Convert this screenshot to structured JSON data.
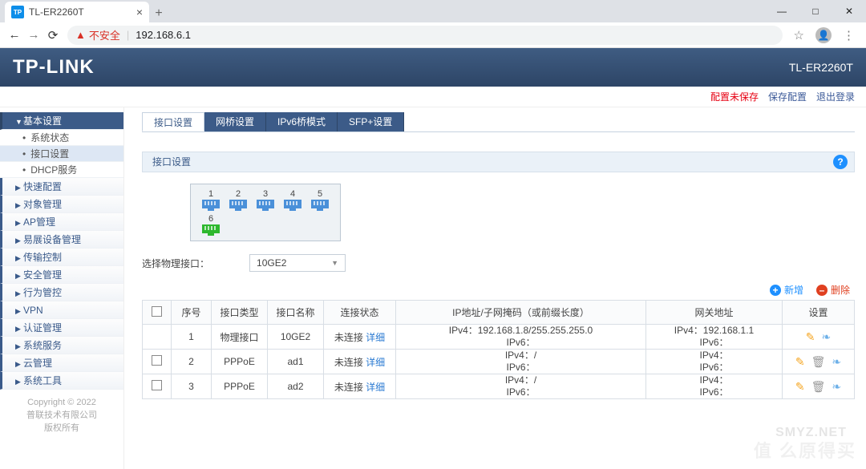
{
  "browser": {
    "tab_title": "TL-ER2260T",
    "favicon": "TP",
    "address_warn": "不安全",
    "address_url": "192.168.6.1",
    "newtab": "+",
    "close": "×",
    "win": {
      "min": "—",
      "max": "□",
      "close": "✕"
    },
    "nav": {
      "back": "←",
      "fwd": "→",
      "reload": "⟳"
    },
    "star": "☆",
    "user_glyph": "●",
    "menu": "⋮"
  },
  "banner": {
    "brand": "TP-LINK",
    "model": "TL-ER2260T"
  },
  "actionbar": {
    "unsaved": "配置未保存",
    "save": "保存配置",
    "logout": "退出登录"
  },
  "sidebar": {
    "items": [
      {
        "label": "基本设置",
        "children": [
          {
            "label": "系统状态"
          },
          {
            "label": "接口设置",
            "active": true
          },
          {
            "label": "DHCP服务"
          }
        ]
      },
      {
        "label": "快速配置"
      },
      {
        "label": "对象管理"
      },
      {
        "label": "AP管理"
      },
      {
        "label": "易展设备管理"
      },
      {
        "label": "传输控制"
      },
      {
        "label": "安全管理"
      },
      {
        "label": "行为管控"
      },
      {
        "label": "VPN"
      },
      {
        "label": "认证管理"
      },
      {
        "label": "系统服务"
      },
      {
        "label": "云管理"
      },
      {
        "label": "系统工具"
      }
    ],
    "copyright": {
      "l1": "Copyright © 2022",
      "l2": "普联技术有限公司",
      "l3": "版权所有"
    }
  },
  "tabs": [
    {
      "label": "接口设置",
      "active": true
    },
    {
      "label": "网桥设置"
    },
    {
      "label": "IPv6桥模式"
    },
    {
      "label": "SFP+设置"
    }
  ],
  "panel": {
    "title": "接口设置",
    "help": "?",
    "ports": [
      {
        "num": "1",
        "state": "blue"
      },
      {
        "num": "2",
        "state": "blue"
      },
      {
        "num": "3",
        "state": "blue"
      },
      {
        "num": "4",
        "state": "blue"
      },
      {
        "num": "5",
        "state": "blue"
      },
      {
        "num": "6",
        "state": "green"
      }
    ],
    "select_label": "选择物理接口：",
    "select_value": "10GE2",
    "actions": {
      "add": "新增",
      "del": "删除"
    },
    "columns": {
      "idx": "序号",
      "type": "接口类型",
      "name": "接口名称",
      "status": "连接状态",
      "ip": "IP地址/子网掩码（或前缀长度）",
      "gw": "网关地址",
      "op": "设置"
    },
    "detail": "详细",
    "rows": [
      {
        "check": false,
        "idx": "1",
        "type": "物理接口",
        "name": "10GE2",
        "status": "未连接",
        "ipv4": "192.168.1.8/255.255.255.0",
        "ipv6": "",
        "gw4": "192.168.1.1",
        "gw6": "",
        "deletable": false
      },
      {
        "check": true,
        "idx": "2",
        "type": "PPPoE",
        "name": "ad1",
        "status": "未连接",
        "ipv4": "/",
        "ipv6": "",
        "gw4": "",
        "gw6": "",
        "deletable": true
      },
      {
        "check": true,
        "idx": "3",
        "type": "PPPoE",
        "name": "ad2",
        "status": "未连接",
        "ipv4": "/",
        "ipv6": "",
        "gw4": "",
        "gw6": "",
        "deletable": true
      }
    ]
  },
  "watermark": {
    "big": "值      么原得买",
    "small": "SMYZ.NET"
  }
}
